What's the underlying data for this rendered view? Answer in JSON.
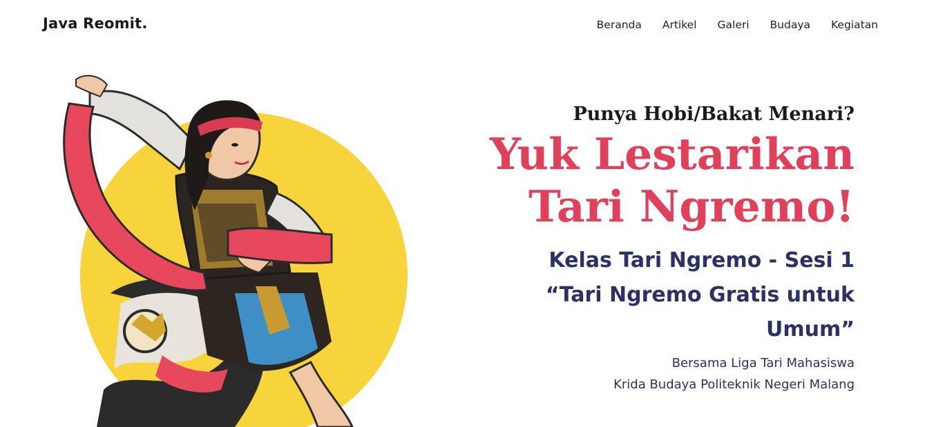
{
  "nav": {
    "brand": "Java Reomit.",
    "links": [
      "Beranda",
      "Artikel",
      "Galeri",
      "Budaya",
      "Kegiatan"
    ]
  },
  "hero": {
    "eyebrow": "Punya Hobi/Bakat Menari?",
    "headline_line1": "Yuk Lestarikan",
    "headline_line2": "Tari Ngremo!",
    "class_line1": "Kelas Tari Ngremo - Sesi 1",
    "class_line2": "“Tari Ngremo Gratis untuk",
    "class_line3": "Umum”",
    "subtitle_line1": "Bersama Liga Tari Mahasiswa",
    "subtitle_line2": "Krida Budaya Politeknik Negeri Malang"
  },
  "colors": {
    "headline": "#e0405a",
    "class_text": "#2a3163",
    "sun": "#f7d33c",
    "scarf": "#e8485d"
  },
  "icons": {
    "hero_illustration": "ngremo-dancer-illustration"
  }
}
